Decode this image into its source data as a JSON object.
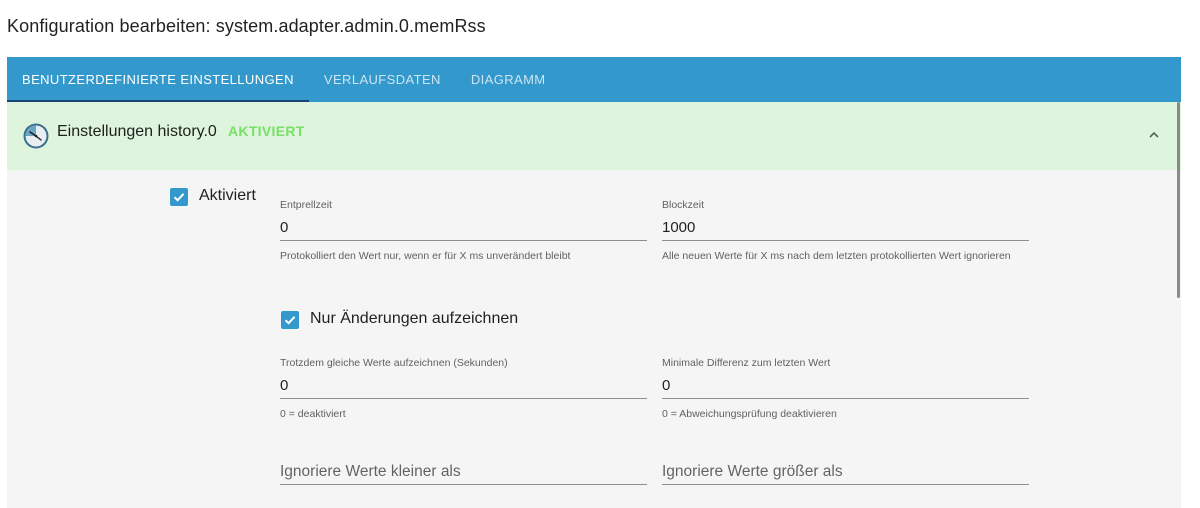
{
  "dialog": {
    "title": "Konfiguration bearbeiten: system.adapter.admin.0.memRss"
  },
  "tabs": [
    {
      "label": "BENUTZERDEFINIERTE EINSTELLUNGEN",
      "active": true
    },
    {
      "label": "VERLAUFSDATEN",
      "active": false
    },
    {
      "label": "DIAGRAMM",
      "active": false
    }
  ],
  "panel": {
    "title": "Einstellungen history.0",
    "status": "AKTIVIERT",
    "icon": "history-clock-icon",
    "expanded": true
  },
  "settings": {
    "enabled": {
      "label": "Aktiviert",
      "checked": true
    },
    "debounce": {
      "label": "Entprellzeit",
      "value": "0",
      "help": "Protokolliert den Wert nur, wenn er für X ms unverändert bleibt"
    },
    "blocktime": {
      "label": "Blockzeit",
      "value": "1000",
      "help": "Alle neuen Werte für X ms nach dem letzten protokollierten Wert ignorieren"
    },
    "changes_only": {
      "label": "Nur Änderungen aufzeichnen",
      "checked": true
    },
    "record_same": {
      "label": "Trotzdem gleiche Werte aufzeichnen (Sekunden)",
      "value": "0",
      "help": "0 = deaktiviert"
    },
    "min_diff": {
      "label": "Minimale Differenz zum letzten Wert",
      "value": "0",
      "help": "0 = Abweichungsprüfung deaktivieren"
    },
    "ignore_below": {
      "placeholder": "Ignoriere Werte kleiner als",
      "value": ""
    },
    "ignore_above": {
      "placeholder": "Ignoriere Werte größer als",
      "value": ""
    }
  },
  "colors": {
    "tabbar": "#3399cc",
    "tab_indicator": "#164477",
    "panel_header": "#dff4dc",
    "status_green": "#77e067",
    "checkbox": "#3399cc",
    "panel_body": "#f5f5f5"
  }
}
